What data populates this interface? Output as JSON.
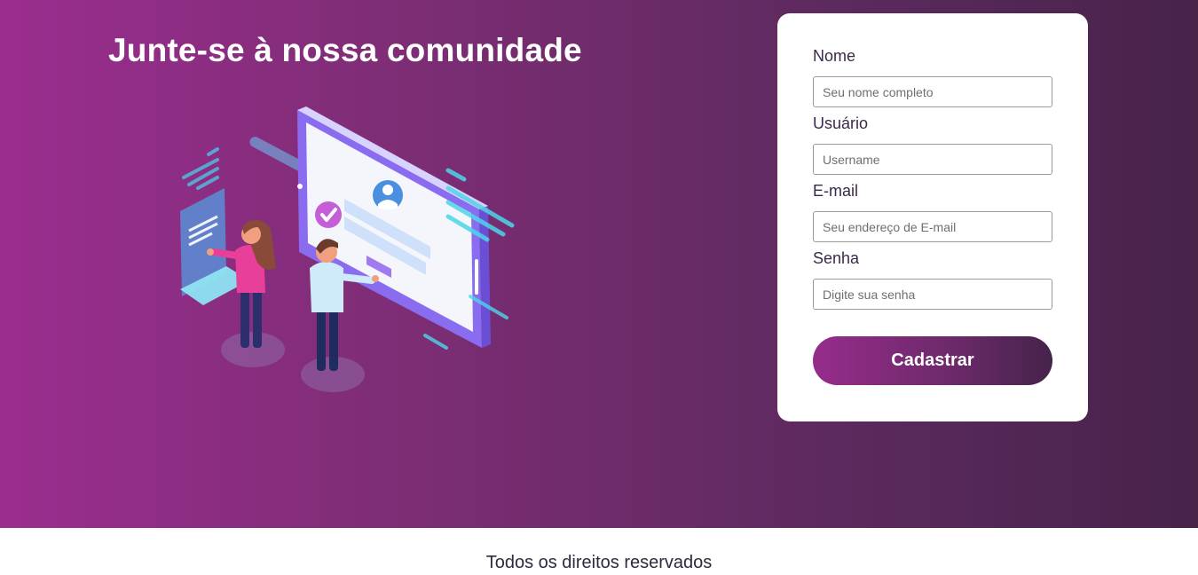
{
  "hero": {
    "title": "Junte-se à nossa comunidade"
  },
  "illustration": {
    "icon": "signup-illustration",
    "colors": {
      "device_frame": "#8c6ff0",
      "screen": "#f4f6fb",
      "accent_cyan": "#4fd6e8",
      "check_badge": "#c55fd8",
      "avatar": "#4a8fe0",
      "woman_shirt": "#e8409a",
      "hair": "#8a4a3a"
    }
  },
  "form": {
    "fields": [
      {
        "label": "Nome",
        "placeholder": "Seu nome completo",
        "type": "text"
      },
      {
        "label": "Usuário",
        "placeholder": "Username",
        "type": "text"
      },
      {
        "label": "E-mail",
        "placeholder": "Seu endereço de E-mail",
        "type": "email"
      },
      {
        "label": "Senha",
        "placeholder": "Digite sua senha",
        "type": "password"
      }
    ],
    "submit_label": "Cadastrar"
  },
  "footer": {
    "text": "Todos os direitos reservados"
  },
  "colors": {
    "gradient_start": "#9b2d8f",
    "gradient_end": "#47234a",
    "card_bg": "#ffffff",
    "label_color": "#3a2a48"
  }
}
